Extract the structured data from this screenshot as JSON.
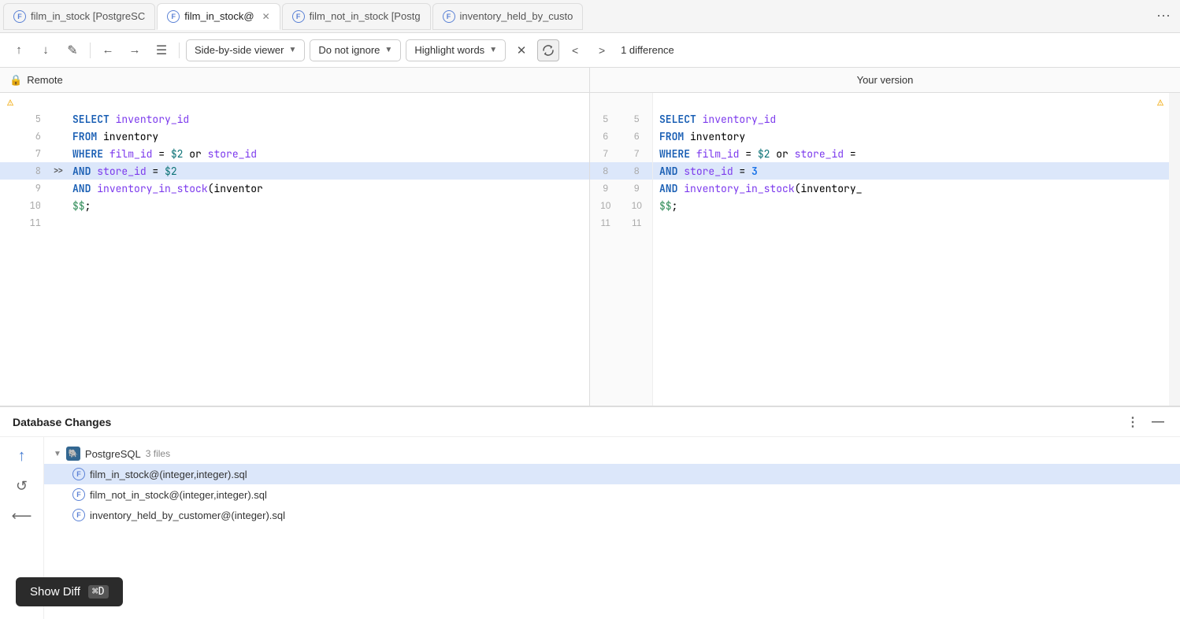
{
  "tabs": [
    {
      "id": "tab1",
      "label": "film_in_stock [PostgreSC",
      "icon": "F",
      "active": false,
      "closable": false
    },
    {
      "id": "tab2",
      "label": "film_in_stock@",
      "icon": "F",
      "active": true,
      "closable": true
    },
    {
      "id": "tab3",
      "label": "film_not_in_stock [Postg",
      "icon": "F",
      "active": false,
      "closable": false
    },
    {
      "id": "tab4",
      "label": "inventory_held_by_custo",
      "icon": "F",
      "active": false,
      "closable": false
    }
  ],
  "tabs_more_label": "⋯",
  "toolbar": {
    "up_arrow": "↑",
    "down_arrow": "↓",
    "edit_icon": "✎",
    "back_icon": "←",
    "forward_icon": "→",
    "list_icon": "≡",
    "viewer_label": "Side-by-side viewer",
    "ignore_label": "Do not ignore",
    "highlight_label": "Highlight words",
    "close_icon": "✕",
    "prev_icon": "<",
    "next_icon": ">",
    "diff_count": "1 difference"
  },
  "diff": {
    "left_header": "Remote",
    "right_header": "Your version",
    "warning_icon": "⚠",
    "lines_left": [
      {
        "num": "5",
        "content_html": "<span class='kw-blue'>SELECT</span> <span class='kw-purple'>inventory_id</span>",
        "highlighted": false
      },
      {
        "num": "6",
        "content_html": "<span class='kw-blue'>FROM</span> inventory",
        "highlighted": false
      },
      {
        "num": "7",
        "content_html": "<span class='kw-blue'>WHERE</span> <span class='kw-purple'>film_id</span> = <span class='val-teal'>$2</span> or <span class='kw-purple'>store_id</span>",
        "highlighted": false
      },
      {
        "num": "8",
        "content_html": "<span class='kw-blue'>AND</span> <span class='kw-purple'>store_id</span> = <span class='val-teal'>$2</span>",
        "highlighted": true,
        "marker": ">>",
        "right_num": "8"
      },
      {
        "num": "9",
        "content_html": "<span class='kw-blue'>AND</span> <span class='kw-purple'>inventory_in_stock</span>(inventor",
        "highlighted": false
      },
      {
        "num": "10",
        "content_html": "<span class='val-green'>$$</span>;",
        "highlighted": false
      },
      {
        "num": "11",
        "content_html": "",
        "highlighted": false
      }
    ],
    "lines_right": [
      {
        "num": "5",
        "content_html": "<span class='kw-blue'>SELECT</span> <span class='kw-purple'>inventory_id</span>",
        "highlighted": false
      },
      {
        "num": "6",
        "content_html": "<span class='kw-blue'>FROM</span> inventory",
        "highlighted": false
      },
      {
        "num": "7",
        "content_html": "<span class='kw-blue'>WHERE</span> <span class='kw-purple'>film_id</span> = <span class='val-teal'>$2</span> or <span class='kw-purple'>store_id</span> =",
        "highlighted": false
      },
      {
        "num": "8",
        "content_html": "<span class='kw-blue'>AND</span> <span class='kw-purple'>store_id</span> = <span class='highlighted-num'>3</span>",
        "highlighted": true
      },
      {
        "num": "9",
        "content_html": "<span class='kw-blue'>AND</span> <span class='kw-purple'>inventory_in_stock</span>(inventory_",
        "highlighted": false
      },
      {
        "num": "10",
        "content_html": "<span class='val-green'>$$</span>;",
        "highlighted": false
      },
      {
        "num": "11",
        "content_html": "",
        "highlighted": false
      }
    ]
  },
  "bottom_panel": {
    "title": "Database Changes",
    "more_icon": "⋮",
    "collapse_icon": "—",
    "actions": [
      {
        "id": "push",
        "icon": "↑",
        "color": "#4a7fd4"
      },
      {
        "id": "revert",
        "icon": "↺",
        "color": "#666"
      },
      {
        "id": "pull",
        "icon": "←",
        "color": "#666"
      }
    ],
    "tree": {
      "group_label": "PostgreSQL",
      "group_count": "3 files",
      "files": [
        {
          "id": "file1",
          "label": "film_in_stock@(integer,integer).sql",
          "active": true
        },
        {
          "id": "file2",
          "label": "film_not_in_stock@(integer,integer).sql",
          "active": false
        },
        {
          "id": "file3",
          "label": "inventory_held_by_customer@(integer).sql",
          "active": false
        }
      ]
    }
  },
  "tooltip": {
    "label": "Show Diff",
    "kbd": "⌘D"
  }
}
